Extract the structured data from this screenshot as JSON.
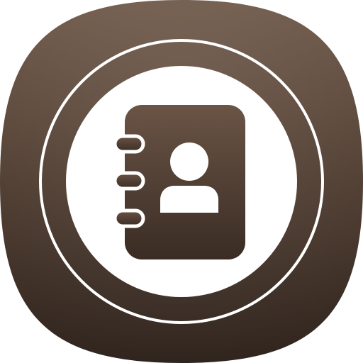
{
  "app_icon": {
    "icon": "contacts-address-book-icon",
    "glyph": "person-icon",
    "colors": {
      "tile_top": "#6e5848",
      "tile_mid": "#4f3c30",
      "tile_bottom": "#2f241d",
      "ring": "#ffffff",
      "disc": "#ffffff",
      "book_top": "#6a5446",
      "book_bottom": "#3a2c23",
      "glyph": "#ffffff"
    }
  }
}
